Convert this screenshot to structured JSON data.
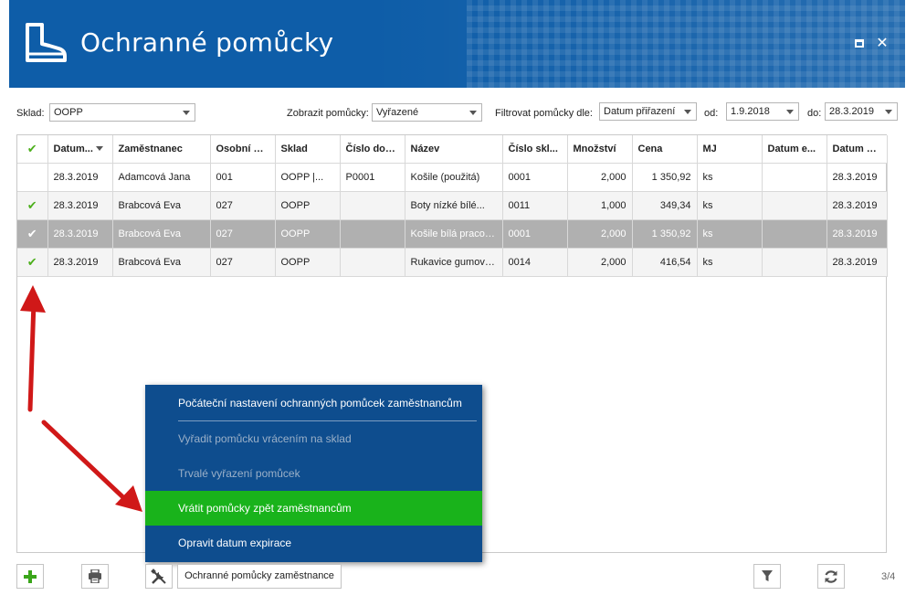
{
  "window": {
    "title": "Ochranné pomůcky",
    "icon": "boot-icon",
    "max_icon": "maximize-icon",
    "close_glyph": "✕"
  },
  "filters": {
    "sklad_label": "Sklad:",
    "sklad_value": "OOPP",
    "zobrazit_label": "Zobrazit pomůcky:",
    "zobrazit_value": "Vyřazené",
    "filtrovat_label": "Filtrovat pomůcky dle:",
    "filtrovat_value": "Datum přiřazení",
    "od_label": "od:",
    "od_value": "1.9.2018",
    "do_label": "do:",
    "do_value": "28.3.2019"
  },
  "table": {
    "headers": [
      "✔",
      "Datum...",
      "Zaměstnanec",
      "Osobní čí...",
      "Sklad",
      "Číslo dok...",
      "Název",
      "Číslo skl...",
      "Množství",
      "Cena",
      "MJ",
      "Datum e...",
      "Datum vy..."
    ],
    "rows": [
      [
        "",
        "28.3.2019",
        "Adamcová Jana",
        "001",
        "OOPP |...",
        "P0001",
        "Košile (použitá)",
        "0001",
        "2,000",
        "1 350,92",
        "ks",
        "",
        "28.3.2019"
      ],
      [
        "✔",
        "28.3.2019",
        "Brabcová Eva",
        "027",
        "OOPP",
        "",
        "Boty nízké bílé...",
        "0011",
        "1,000",
        "349,34",
        "ks",
        "",
        "28.3.2019"
      ],
      [
        "✔",
        "28.3.2019",
        "Brabcová Eva",
        "027",
        "OOPP",
        "",
        "Košile bílá pracovní",
        "0001",
        "2,000",
        "1 350,92",
        "ks",
        "",
        "28.3.2019"
      ],
      [
        "✔",
        "28.3.2019",
        "Brabcová Eva",
        "027",
        "OOPP",
        "",
        "Rukavice gumové ...",
        "0014",
        "2,000",
        "416,54",
        "ks",
        "",
        "28.3.2019"
      ]
    ],
    "selected_row": 2
  },
  "menu": {
    "items": [
      {
        "label": "Počáteční nastavení ochranných pomůcek zaměstnancům",
        "state": "normal"
      },
      {
        "label": "Vyřadit pomůcku vrácením na sklad",
        "state": "disabled"
      },
      {
        "label": "Trvalé vyřazení pomůcek",
        "state": "disabled"
      },
      {
        "label": "Vrátit pomůcky zpět zaměstnancům",
        "state": "active"
      },
      {
        "label": "Opravit datum expirace",
        "state": "normal"
      }
    ]
  },
  "toolbar": {
    "employee_aids_label": "Ochranné pomůcky zaměstnance",
    "pager": "3/4"
  },
  "colors": {
    "header_blue": "#0e5da8",
    "menu_blue": "#0e4d8e",
    "menu_active": "#19b31b",
    "check_green": "#4caf1c",
    "selected_row": "#b0b0b0",
    "arrow_red": "#d01818"
  }
}
